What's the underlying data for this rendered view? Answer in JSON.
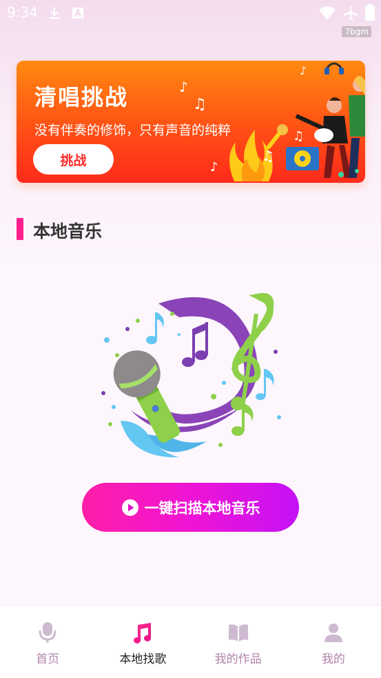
{
  "status_bar": {
    "time": "9:34",
    "watermark": "7bgm",
    "icons": [
      "download-icon",
      "a-icon",
      "wifi-icon",
      "airplane-icon",
      "battery-icon"
    ]
  },
  "banner": {
    "title": "清唱挑战",
    "subtitle": "没有伴奏的修饰，只有声音的纯粹",
    "button_label": "挑战"
  },
  "section": {
    "title": "本地音乐"
  },
  "scan_button": {
    "label": "一键扫描本地音乐"
  },
  "bottom_nav": {
    "items": [
      {
        "label": "首页",
        "icon": "microphone-icon",
        "active": false
      },
      {
        "label": "本地找歌",
        "icon": "music-note-icon",
        "active": true
      },
      {
        "label": "我的作品",
        "icon": "book-icon",
        "active": false
      },
      {
        "label": "我的",
        "icon": "user-icon",
        "active": false
      }
    ]
  },
  "colors": {
    "accent": "#ff1f8e",
    "nav_inactive": "#b084aa",
    "banner_orange": "#ff8a10",
    "banner_red": "#ff2a1a"
  }
}
